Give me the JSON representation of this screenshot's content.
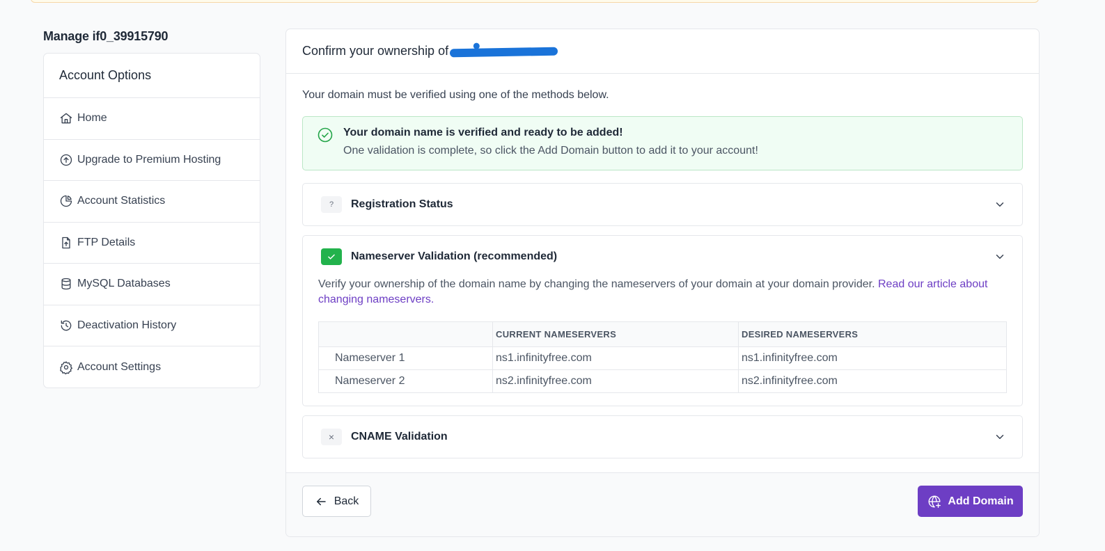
{
  "colors": {
    "accent": "#6d3ec4",
    "success": "#22b24c",
    "redaction": "#1a73d9"
  },
  "page": {
    "manage_title": "Manage if0_39915790"
  },
  "sidebar": {
    "header": "Account Options",
    "items": [
      {
        "label": "Home",
        "icon": "home-icon"
      },
      {
        "label": "Upgrade to Premium Hosting",
        "icon": "upgrade-arrow-icon"
      },
      {
        "label": "Account Statistics",
        "icon": "pie-chart-icon"
      },
      {
        "label": "FTP Details",
        "icon": "file-upload-icon"
      },
      {
        "label": "MySQL Databases",
        "icon": "database-icon"
      },
      {
        "label": "Deactivation History",
        "icon": "history-icon"
      },
      {
        "label": "Account Settings",
        "icon": "gear-icon"
      }
    ]
  },
  "card": {
    "title": "Confirm your ownership of",
    "intro": "Your domain must be verified using one of the methods below.",
    "alert": {
      "title": "Your domain name is verified and ready to be added!",
      "text": "One validation is complete, so click the Add Domain button to add it to your account!"
    },
    "sections": {
      "registration": {
        "title": "Registration Status",
        "badge": "?"
      },
      "nameserver": {
        "title": "Nameserver Validation (recommended)",
        "description": "Verify your ownership of the domain name by changing the nameservers of your domain at your domain provider.",
        "link": "Read our article about changing nameservers.",
        "table": {
          "headers": [
            "",
            "CURRENT NAMESERVERS",
            "DESIRED NAMESERVERS"
          ],
          "rows": [
            [
              "Nameserver 1",
              "ns1.infinityfree.com",
              "ns1.infinityfree.com"
            ],
            [
              "Nameserver 2",
              "ns2.infinityfree.com",
              "ns2.infinityfree.com"
            ]
          ]
        }
      },
      "cname": {
        "title": "CNAME Validation",
        "badge": "×"
      }
    }
  },
  "footer": {
    "back_label": "Back",
    "add_domain_label": "Add Domain"
  }
}
